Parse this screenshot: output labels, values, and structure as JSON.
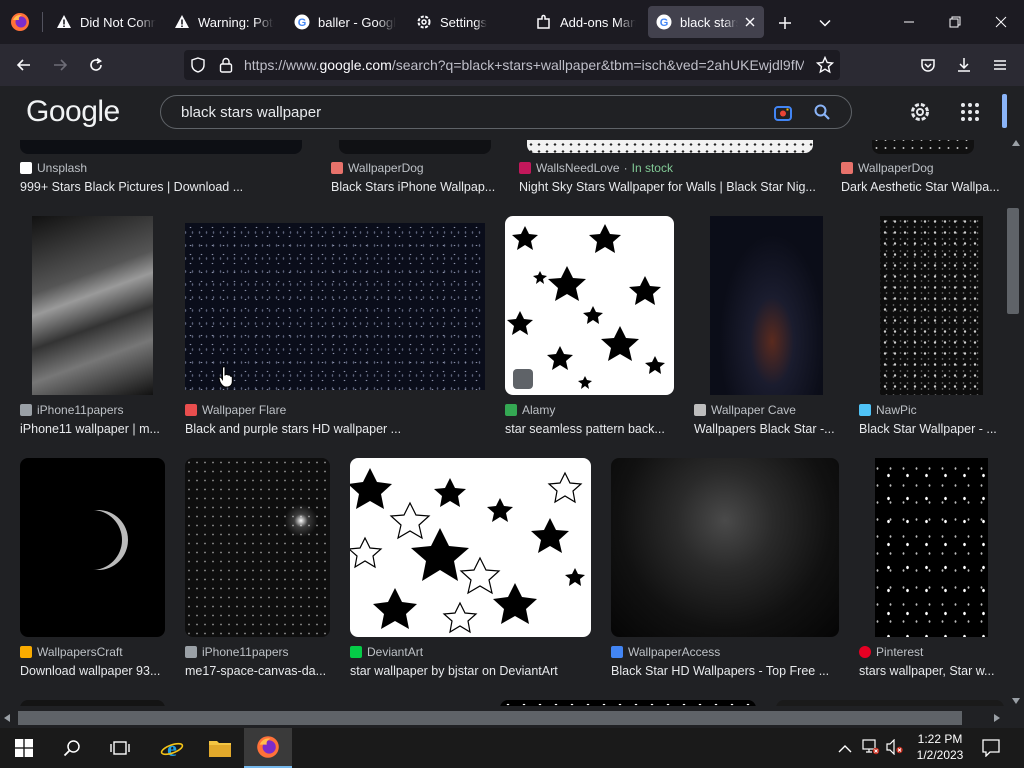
{
  "browser": {
    "tabs": [
      {
        "title": "Did Not Conne",
        "icon": "warning-icon"
      },
      {
        "title": "Warning: Pote",
        "icon": "warning-icon"
      },
      {
        "title": "baller - Google",
        "icon": "google-icon"
      },
      {
        "title": "Settings",
        "icon": "gear-icon"
      },
      {
        "title": "Add-ons Mana",
        "icon": "puzzle-icon"
      },
      {
        "title": "black stars w",
        "icon": "google-icon",
        "active": true
      }
    ],
    "url_prefix": "https://www.",
    "url_domain": "google.com",
    "url_rest": "/search?q=black+stars+wallpaper&tbm=isch&ved=2ahUKEwjdl9fM"
  },
  "google": {
    "logo": "Google",
    "query": "black stars wallpaper"
  },
  "results": {
    "row0": [
      {
        "source": "Unsplash",
        "caption": "999+ Stars Black Pictures | Download ...",
        "fav_color": "#ffffff"
      },
      {
        "source": "WallpaperDog",
        "caption": "Black Stars iPhone Wallpap...",
        "fav_color": "#e8726b"
      },
      {
        "source": "WallsNeedLove",
        "stock": "In stock",
        "caption": "Night Sky Stars Wallpaper for Walls | Black Star Nig...",
        "fav_color": "#c2185b"
      },
      {
        "source": "WallpaperDog",
        "caption": "Dark Aesthetic Star Wallpa...",
        "fav_color": "#e8726b"
      }
    ],
    "row1": [
      {
        "source": "iPhone11papers",
        "caption": "iPhone11 wallpaper | m...",
        "fav_color": "#9aa0a6"
      },
      {
        "source": "Wallpaper Flare",
        "caption": "Black and purple stars HD wallpaper ...",
        "fav_color": "#e94e4e"
      },
      {
        "source": "Alamy",
        "caption": "star seamless pattern back...",
        "fav_color": "#34a853",
        "badge": "alamy"
      },
      {
        "source": "Wallpaper Cave",
        "caption": "Wallpapers Black Star -...",
        "fav_color": "#bdbdbd"
      },
      {
        "source": "NawPic",
        "caption": "Black Star Wallpaper - ...",
        "fav_color": "#4fc3f7"
      }
    ],
    "row2": [
      {
        "source": "WallpapersCraft",
        "caption": "Download wallpaper 93...",
        "fav_color": "#f9ab00"
      },
      {
        "source": "iPhone11papers",
        "caption": "me17-space-canvas-da...",
        "fav_color": "#9aa0a6"
      },
      {
        "source": "DeviantArt",
        "caption": "star wallpaper by bjstar on DeviantArt",
        "fav_color": "#05cc47"
      },
      {
        "source": "WallpaperAccess",
        "caption": "Black Star HD Wallpapers - Top Free ...",
        "fav_color": "#4285f4"
      },
      {
        "source": "Pinterest",
        "caption": "stars wallpaper, Star w...",
        "fav_color": "#e60023"
      }
    ]
  },
  "taskbar": {
    "time": "1:22 PM",
    "date": "1/2/2023"
  },
  "colors": {
    "tabstrip": "#1c1b22",
    "navbar": "#2b2a33",
    "page_bg": "#202124",
    "accent": "#8ab4f8"
  }
}
